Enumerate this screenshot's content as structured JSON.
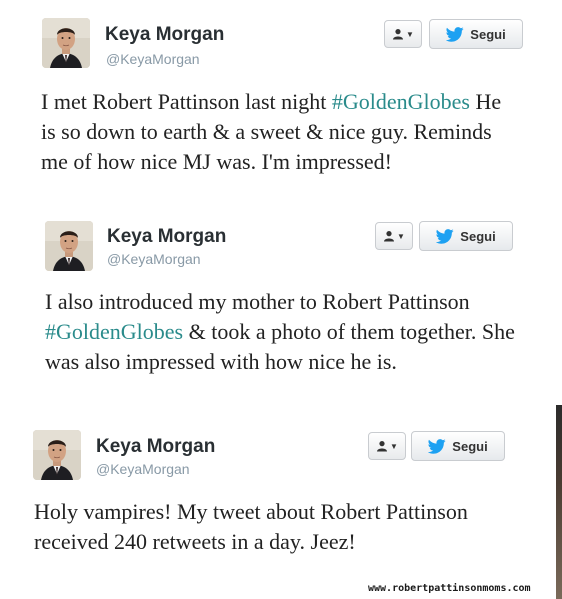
{
  "colors": {
    "hashtag": "#2a8b8b",
    "name": "#292f33",
    "handle": "#8899a6",
    "twitter_bird": "#1da1f2"
  },
  "tweets": [
    {
      "name": "Keya Morgan",
      "handle": "@KeyaMorgan",
      "follow_label": "Segui",
      "user_menu_icon": "user-dropdown-icon",
      "text_parts": [
        "I met Robert Pattinson last night",
        "#GoldenGlobes",
        "He is so down to earth & a sweet & nice guy. Reminds me of how nice MJ was. I'm impressed!"
      ]
    },
    {
      "name": "Keya Morgan",
      "handle": "@KeyaMorgan",
      "follow_label": "Segui",
      "user_menu_icon": "user-dropdown-icon",
      "text_parts": [
        "I also introduced my mother to Robert Pattinson",
        "#GoldenGlobes",
        "& took a photo of them together. She was also impressed with how nice he is."
      ]
    },
    {
      "name": "Keya Morgan",
      "handle": "@KeyaMorgan",
      "follow_label": "Segui",
      "user_menu_icon": "user-dropdown-icon",
      "text_parts": [
        "Holy vampires! My tweet about Robert Pattinson received 240 retweets in a day. Jeez!"
      ]
    }
  ],
  "watermark": "www.robertpattinsonmoms.com"
}
